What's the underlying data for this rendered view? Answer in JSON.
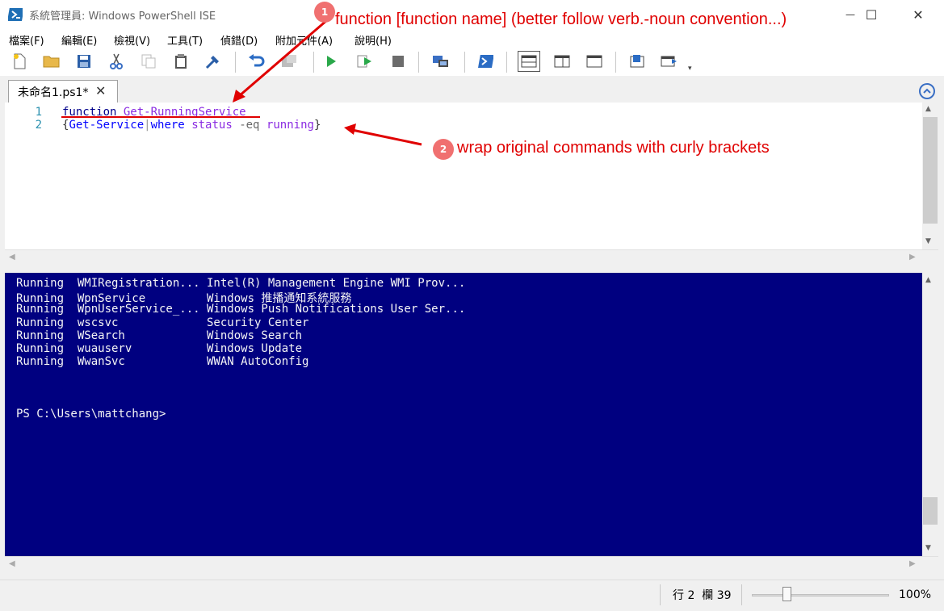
{
  "window": {
    "title": "系統管理員: Windows PowerShell ISE",
    "minimize_symbol": "—",
    "maximize_symbol": "☐",
    "close_symbol": "✕"
  },
  "menu": [
    "檔案(F)",
    "編輯(E)",
    "檢視(V)",
    "工具(T)",
    "偵錯(D)",
    "附加元件(A)",
    "說明(H)"
  ],
  "toolbar_icons": [
    "new-icon",
    "open-icon",
    "save-icon",
    "cut-icon",
    "copy-icon",
    "paste-icon",
    "clear-icon",
    "undo-icon",
    "redo-icon",
    "run-icon",
    "run-selection-icon",
    "stop-icon",
    "remote-icon",
    "powershell-icon",
    "layout-top-icon",
    "layout-right-icon",
    "layout-max-icon",
    "show-script-icon",
    "show-console-icon"
  ],
  "tab": {
    "label": "未命名1.ps1*",
    "close_symbol": "✕"
  },
  "editor": {
    "line_numbers": [
      "1",
      "2"
    ],
    "line1": {
      "keyword": "function",
      "name": "Get-RunningService"
    },
    "line2": {
      "open_brace": "{",
      "cmd": "Get-Service",
      "pipe": "|",
      "where": "where",
      "param": "status",
      "op": "-eq",
      "value": "running",
      "close_brace": "}"
    }
  },
  "console": {
    "lines": [
      "Running  WMIRegistration... Intel(R) Management Engine WMI Prov...",
      "Running  WpnService         Windows 推播通知系統服務",
      "Running  WpnUserService_... Windows Push Notifications User Ser...",
      "Running  wscsvc             Security Center",
      "Running  WSearch            Windows Search",
      "Running  wuauserv           Windows Update",
      "Running  WwanSvc            WWAN AutoConfig"
    ],
    "prompt": "PS C:\\Users\\mattchang>"
  },
  "status": {
    "position": "行 2  欄 39",
    "zoom": "100%",
    "zoom_level": 0.5
  },
  "annotations": [
    {
      "number": "1",
      "text": "function [function name] (better follow verb.-noun convention...)"
    },
    {
      "number": "2",
      "text": "wrap original commands with curly brackets"
    }
  ],
  "colors": {
    "console_bg": "#000080",
    "annotation": "#e00000",
    "keyword": "#00008b",
    "function_name": "#8a2be2"
  }
}
